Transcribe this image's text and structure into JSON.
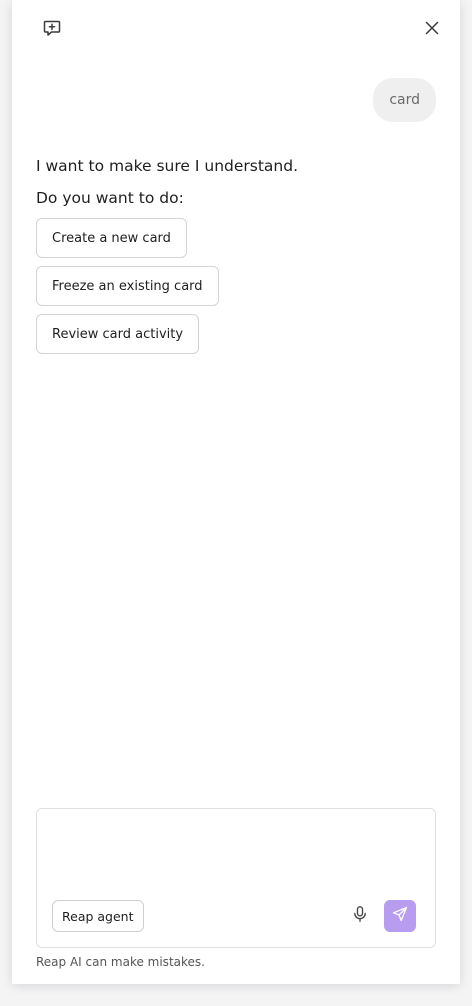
{
  "header": {
    "new_chat_icon": "message-plus-icon",
    "close_icon": "close-icon"
  },
  "conversation": {
    "user_message": "card",
    "assistant_line1": "I want to make sure I understand.",
    "assistant_line2": "Do you want to do:",
    "options": [
      "Create a new card",
      "Freeze an existing card",
      "Review card activity"
    ]
  },
  "composer": {
    "input_value": "",
    "agent_label": "Reap agent",
    "mic_icon": "microphone-icon",
    "send_icon": "send-icon",
    "send_color": "#b79cf0"
  },
  "footer": {
    "disclaimer": "Reap AI can make mistakes."
  }
}
